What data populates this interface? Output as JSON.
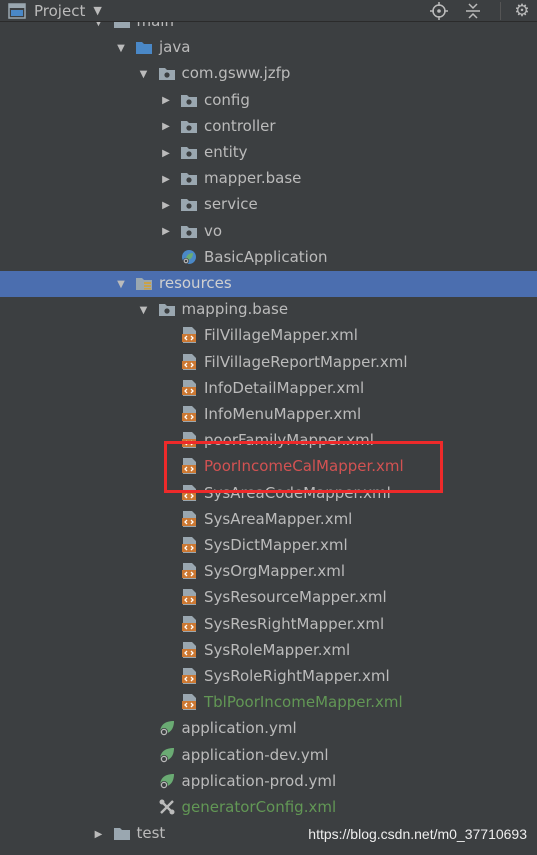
{
  "header": {
    "title": "Project",
    "icon": "project-window-icon",
    "actions": [
      "locate-target-icon",
      "collapse-all-icon",
      "gear-icon"
    ]
  },
  "tree": {
    "items": [
      {
        "label": "main",
        "icon": "folder-icon",
        "arrow": "expanded",
        "level": 2
      },
      {
        "label": "java",
        "icon": "source-folder-icon",
        "arrow": "expanded",
        "level": 3
      },
      {
        "label": "com.gsww.jzfp",
        "icon": "package-icon",
        "arrow": "expanded",
        "level": 4
      },
      {
        "label": "config",
        "icon": "package-icon",
        "arrow": "collapsed",
        "level": 5
      },
      {
        "label": "controller",
        "icon": "package-icon",
        "arrow": "collapsed",
        "level": 5
      },
      {
        "label": "entity",
        "icon": "package-icon",
        "arrow": "collapsed",
        "level": 5
      },
      {
        "label": "mapper.base",
        "icon": "package-icon",
        "arrow": "collapsed",
        "level": 5
      },
      {
        "label": "service",
        "icon": "package-icon",
        "arrow": "collapsed",
        "level": 5
      },
      {
        "label": "vo",
        "icon": "package-icon",
        "arrow": "collapsed",
        "level": 5
      },
      {
        "label": "BasicApplication",
        "icon": "spring-boot-class-icon",
        "arrow": "none",
        "level": 5
      },
      {
        "label": "resources",
        "icon": "resources-folder-icon",
        "arrow": "expanded",
        "level": 3,
        "selected": true
      },
      {
        "label": "mapping.base",
        "icon": "package-icon",
        "arrow": "expanded",
        "level": 4
      },
      {
        "label": "FilVillageMapper.xml",
        "icon": "xml-file-icon",
        "arrow": "none",
        "level": 5
      },
      {
        "label": "FilVillageReportMapper.xml",
        "icon": "xml-file-icon",
        "arrow": "none",
        "level": 5
      },
      {
        "label": "InfoDetailMapper.xml",
        "icon": "xml-file-icon",
        "arrow": "none",
        "level": 5
      },
      {
        "label": "InfoMenuMapper.xml",
        "icon": "xml-file-icon",
        "arrow": "none",
        "level": 5
      },
      {
        "label": "poorFamilyMapper.xml",
        "icon": "xml-file-icon",
        "arrow": "none",
        "level": 5
      },
      {
        "label": "PoorIncomeCalMapper.xml",
        "icon": "xml-file-icon",
        "arrow": "none",
        "level": 5,
        "status": "error"
      },
      {
        "label": "SysAreaCodeMapper.xml",
        "icon": "xml-file-icon",
        "arrow": "none",
        "level": 5
      },
      {
        "label": "SysAreaMapper.xml",
        "icon": "xml-file-icon",
        "arrow": "none",
        "level": 5
      },
      {
        "label": "SysDictMapper.xml",
        "icon": "xml-file-icon",
        "arrow": "none",
        "level": 5
      },
      {
        "label": "SysOrgMapper.xml",
        "icon": "xml-file-icon",
        "arrow": "none",
        "level": 5
      },
      {
        "label": "SysResourceMapper.xml",
        "icon": "xml-file-icon",
        "arrow": "none",
        "level": 5
      },
      {
        "label": "SysResRightMapper.xml",
        "icon": "xml-file-icon",
        "arrow": "none",
        "level": 5
      },
      {
        "label": "SysRoleMapper.xml",
        "icon": "xml-file-icon",
        "arrow": "none",
        "level": 5
      },
      {
        "label": "SysRoleRightMapper.xml",
        "icon": "xml-file-icon",
        "arrow": "none",
        "level": 5
      },
      {
        "label": "TblPoorIncomeMapper.xml",
        "icon": "xml-file-icon",
        "arrow": "none",
        "level": 5,
        "status": "added"
      },
      {
        "label": "application.yml",
        "icon": "spring-yml-icon",
        "arrow": "none",
        "level": 4
      },
      {
        "label": "application-dev.yml",
        "icon": "spring-yml-icon",
        "arrow": "none",
        "level": 4
      },
      {
        "label": "application-prod.yml",
        "icon": "spring-yml-icon",
        "arrow": "none",
        "level": 4
      },
      {
        "label": "generatorConfig.xml",
        "icon": "tools-xml-icon",
        "arrow": "none",
        "level": 4,
        "status": "added"
      },
      {
        "label": "test",
        "icon": "folder-icon",
        "arrow": "collapsed",
        "level": 2
      }
    ]
  },
  "watermark": "https://blog.csdn.net/m0_37710693",
  "colors": {
    "background": "#3c3f41",
    "selection": "#4b6eaf",
    "text": "#bbbbbb",
    "error_text": "#d25252",
    "added_text": "#629755",
    "highlight_box": "#ee2a2a"
  }
}
